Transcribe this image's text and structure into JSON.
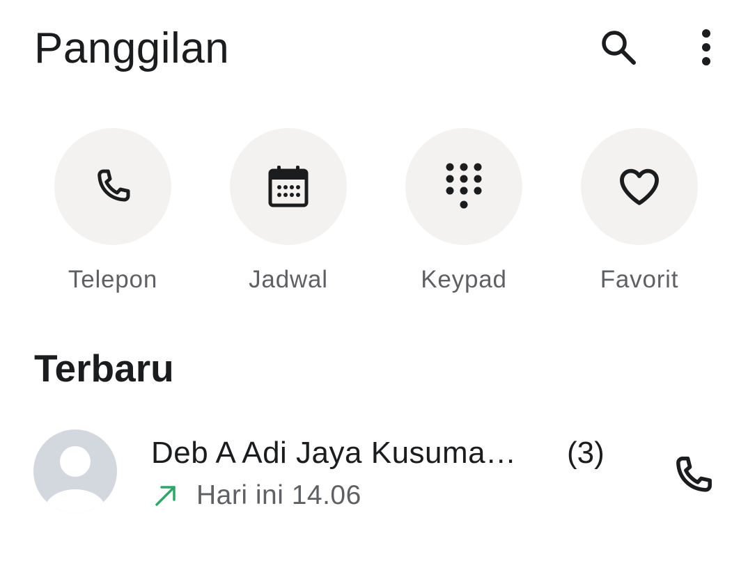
{
  "header": {
    "title": "Panggilan",
    "search_icon": "search-icon",
    "more_icon": "more-vert-icon"
  },
  "actions": [
    {
      "label": "Telepon",
      "icon": "phone-icon"
    },
    {
      "label": "Jadwal",
      "icon": "calendar-icon"
    },
    {
      "label": "Keypad",
      "icon": "dialpad-icon"
    },
    {
      "label": "Favorit",
      "icon": "heart-icon"
    }
  ],
  "recent": {
    "title": "Terbaru",
    "items": [
      {
        "name": "Deb A Adi Jaya Kusuma…",
        "count": "(3)",
        "direction_icon": "outgoing-call-arrow-icon",
        "time": "Hari ini 14.06",
        "avatar_icon": "person-icon",
        "call_icon": "phone-icon"
      }
    ]
  },
  "colors": {
    "background": "#ffffff",
    "text_primary": "#1b1c1e",
    "text_secondary": "#5f6064",
    "action_circle": "#f3f2f1",
    "avatar_bg": "#d3d8de",
    "outgoing_green": "#2aa868"
  }
}
